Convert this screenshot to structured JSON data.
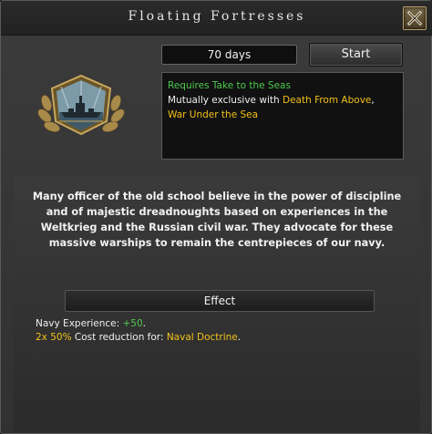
{
  "window": {
    "title": "Floating Fortresses"
  },
  "toolbar": {
    "days": "70 days",
    "start_label": "Start"
  },
  "icons": {
    "close": "close-icon",
    "focus": "battleship-focus-emblem-icon"
  },
  "requirements": {
    "requires_text": "Requires Take to the Seas",
    "exclusive_prefix": "Mutually exclusive with ",
    "exclusive_1": "Death From Above",
    "exclusive_sep": ",",
    "exclusive_2": "War Under the Sea"
  },
  "description": "Many officer of the old school believe in the power of discipline and of majestic dreadnoughts based on experiences in the Weltkrieg and the Russian civil war. They advocate for these massive warships to remain the centrepieces of our navy.",
  "effect": {
    "header": "Effect",
    "line1_label": "Navy Experience: ",
    "line1_value": "+50",
    "line1_end": ".",
    "line2_amount": "2x 50%",
    "line2_text": " Cost reduction for: ",
    "line2_target": "Naval Doctrine",
    "line2_end": "."
  },
  "colors": {
    "positive": "#4ec94e",
    "highlight": "#f2c01a",
    "text": "#f0f0f0"
  }
}
